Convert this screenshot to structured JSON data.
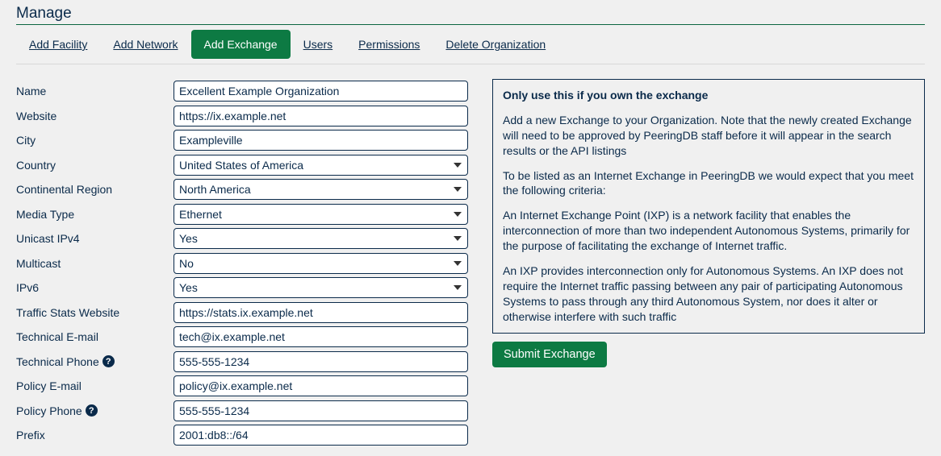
{
  "page_title": "Manage",
  "tabs": [
    {
      "label": "Add Facility",
      "active": false
    },
    {
      "label": "Add Network",
      "active": false
    },
    {
      "label": "Add Exchange",
      "active": true
    },
    {
      "label": "Users",
      "active": false
    },
    {
      "label": "Permissions",
      "active": false
    },
    {
      "label": "Delete Organization",
      "active": false
    }
  ],
  "form": {
    "fields": [
      {
        "label": "Name",
        "type": "text",
        "value": "Excellent Example Organization",
        "name": "name"
      },
      {
        "label": "Website",
        "type": "text",
        "value": "https://ix.example.net",
        "name": "website"
      },
      {
        "label": "City",
        "type": "text",
        "value": "Exampleville",
        "name": "city"
      },
      {
        "label": "Country",
        "type": "select",
        "value": "United States of America",
        "name": "country"
      },
      {
        "label": "Continental Region",
        "type": "select",
        "value": "North America",
        "name": "continental-region"
      },
      {
        "label": "Media Type",
        "type": "select",
        "value": "Ethernet",
        "name": "media-type"
      },
      {
        "label": "Unicast IPv4",
        "type": "select",
        "value": "Yes",
        "name": "unicast-ipv4"
      },
      {
        "label": "Multicast",
        "type": "select",
        "value": "No",
        "name": "multicast"
      },
      {
        "label": "IPv6",
        "type": "select",
        "value": "Yes",
        "name": "ipv6"
      },
      {
        "label": "Traffic Stats Website",
        "type": "text",
        "value": "https://stats.ix.example.net",
        "name": "traffic-stats-website"
      },
      {
        "label": "Technical E-mail",
        "type": "text",
        "value": "tech@ix.example.net",
        "name": "technical-email"
      },
      {
        "label": "Technical Phone",
        "type": "text",
        "value": "555-555-1234",
        "name": "technical-phone",
        "help": true
      },
      {
        "label": "Policy E-mail",
        "type": "text",
        "value": "policy@ix.example.net",
        "name": "policy-email"
      },
      {
        "label": "Policy Phone",
        "type": "text",
        "value": "555-555-1234",
        "name": "policy-phone",
        "help": true
      },
      {
        "label": "Prefix",
        "type": "text",
        "value": "2001:db8::/64",
        "name": "prefix"
      }
    ]
  },
  "info": {
    "heading": "Only use this if you own the exchange",
    "p1": "Add a new Exchange to your Organization. Note that the newly created Exchange will need to be approved by PeeringDB staff before it will appear in the search results or the API listings",
    "p2": "To be listed as an Internet Exchange in PeeringDB we would expect that you meet the following criteria:",
    "p3": "An Internet Exchange Point (IXP) is a network facility that enables the interconnection of more than two independent Autonomous Systems, primarily for the purpose of facilitating the exchange of Internet traffic.",
    "p4": "An IXP provides interconnection only for Autonomous Systems. An IXP does not require the Internet traffic passing between any pair of participating Autonomous Systems to pass through any third Autonomous System, nor does it alter or otherwise interfere with such traffic"
  },
  "submit_label": "Submit Exchange"
}
